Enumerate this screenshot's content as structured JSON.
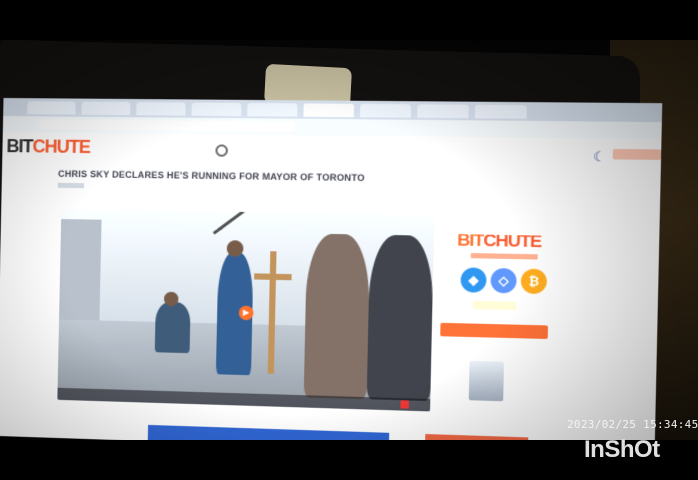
{
  "site": {
    "logo_bit": "BIT",
    "logo_chute": "CHUTE",
    "video_title": "CHRIS SKY DECLARES HE'S RUNNING FOR MAYOR OF TORONTO",
    "sidebar_logo_bit": "BIT",
    "sidebar_logo_chute": "CHUTE"
  },
  "overlay": {
    "timestamp": "2023/02/25  15:34:45",
    "watermark": "InShOt"
  },
  "colors": {
    "brand_orange": "#e8542a",
    "nav_blue": "#2d5fc5"
  }
}
